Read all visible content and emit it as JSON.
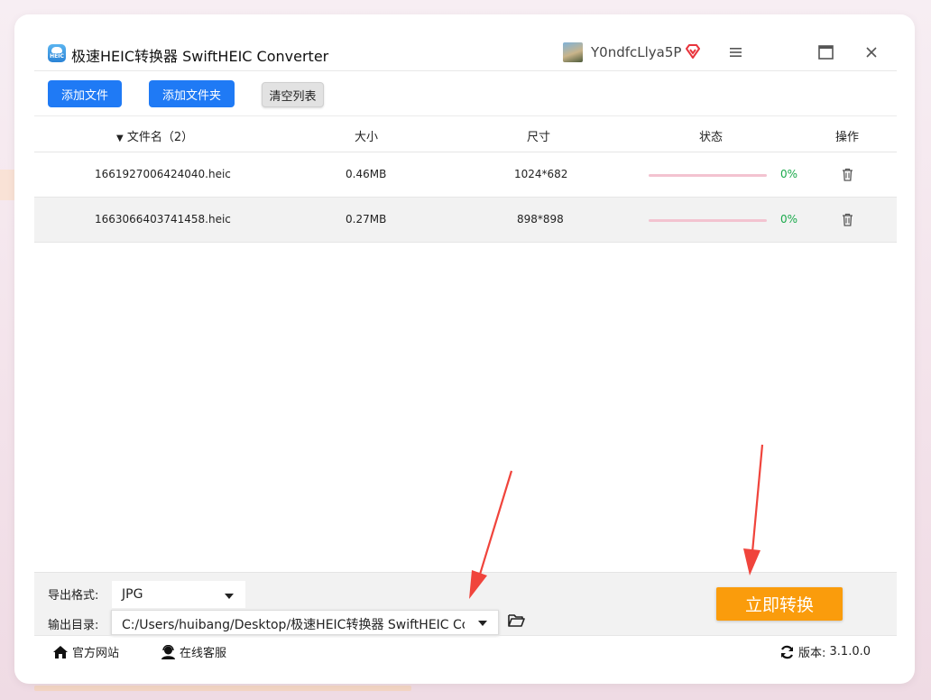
{
  "window": {
    "title": "极速HEIC转换器 SwiftHEIC Converter",
    "logo_text": "HEIC",
    "username": "Y0ndfcLlya5P"
  },
  "toolbar": {
    "add_file": "添加文件",
    "add_folder": "添加文件夹",
    "clear_list": "清空列表"
  },
  "table": {
    "columns": {
      "name": "文件名（2）",
      "size": "大小",
      "dimensions": "尺寸",
      "status": "状态",
      "action": "操作"
    },
    "rows": [
      {
        "name": "1661927006424040.heic",
        "size": "0.46MB",
        "dimensions": "1024*682",
        "progress": 0,
        "percent": "0%"
      },
      {
        "name": "1663066403741458.heic",
        "size": "0.27MB",
        "dimensions": "898*898",
        "progress": 0,
        "percent": "0%"
      }
    ]
  },
  "settings": {
    "format_label": "导出格式:",
    "format_value": "JPG",
    "dir_label": "输出目录:",
    "dir_value": "C:/Users/huibang/Desktop/极速HEIC转换器 SwiftHEIC Converter",
    "convert_button": "立即转换"
  },
  "footer": {
    "website": "官方网站",
    "support": "在线客服",
    "version_label": "版本:",
    "version_value": "3.1.0.0"
  },
  "colors": {
    "primary_blue": "#1f7af5",
    "convert_orange": "#fa9c0c",
    "progress_pink": "#f3c3d0",
    "percent_green": "#19a94a",
    "annotation_red": "#f0443c"
  }
}
